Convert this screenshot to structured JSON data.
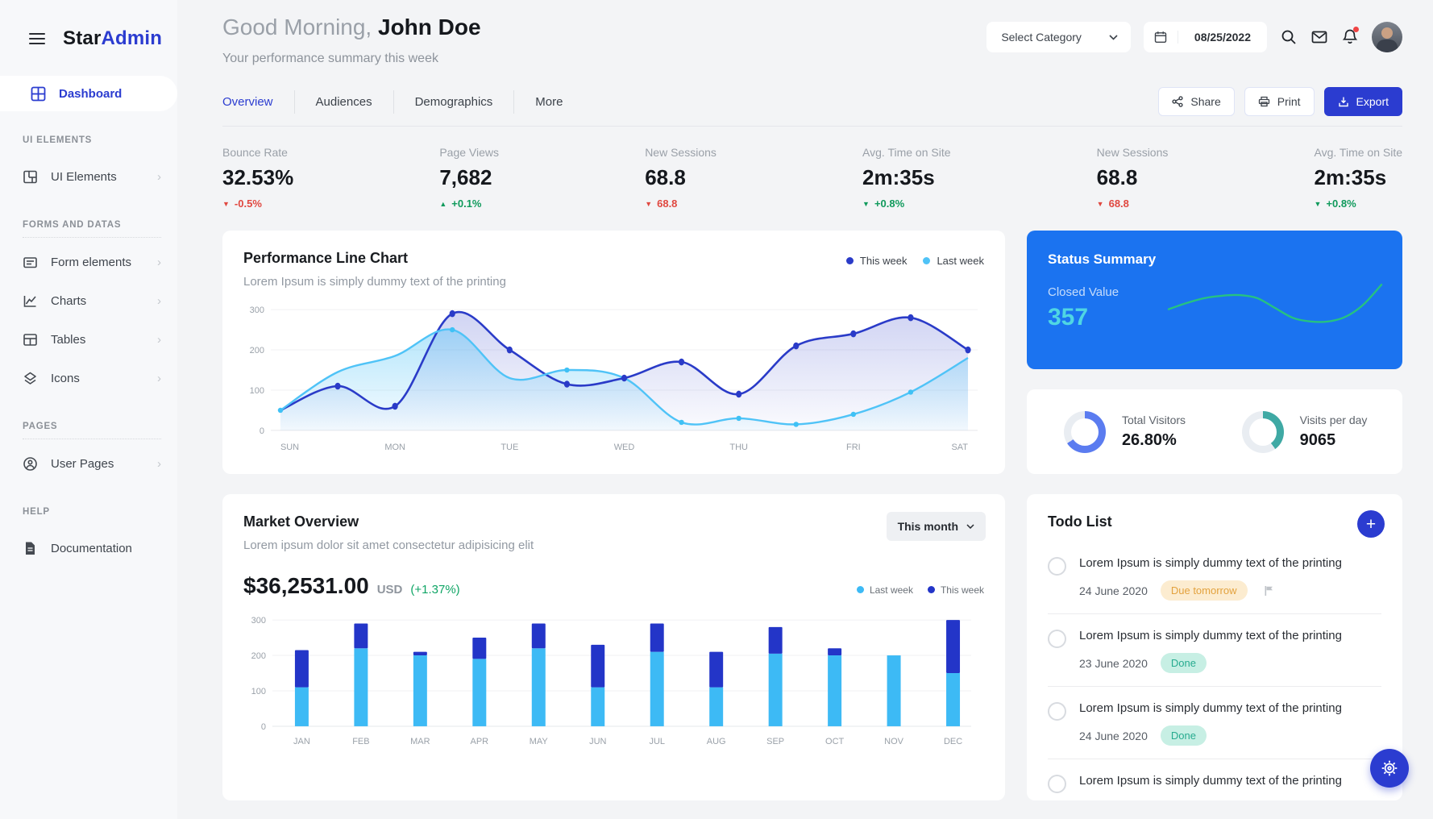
{
  "colors": {
    "primary": "#2b3cd0",
    "status_blue": "#1b73f0",
    "red": "#e04840",
    "green": "#109a5c",
    "grid": "#eef0f2"
  },
  "brand": {
    "star": "Star",
    "admin": "Admin"
  },
  "sidebar": {
    "active": "Dashboard",
    "sections": [
      {
        "title": "UI ELEMENTS",
        "items": [
          {
            "label": "UI Elements",
            "icon": "layout-icon",
            "chevron": true
          }
        ]
      },
      {
        "title": "FORMS AND DATAS",
        "items": [
          {
            "label": "Form elements",
            "icon": "form-icon",
            "chevron": true
          },
          {
            "label": "Charts",
            "icon": "chart-icon",
            "chevron": true
          },
          {
            "label": "Tables",
            "icon": "table-icon",
            "chevron": true
          },
          {
            "label": "Icons",
            "icon": "layers-icon",
            "chevron": true
          }
        ]
      },
      {
        "title": "PAGES",
        "items": [
          {
            "label": "User Pages",
            "icon": "user-icon",
            "chevron": true
          }
        ]
      },
      {
        "title": "HELP",
        "items": [
          {
            "label": "Documentation",
            "icon": "document-icon",
            "chevron": false
          }
        ]
      }
    ]
  },
  "header": {
    "greeting": "Good Morning,",
    "user": "John Doe",
    "subtitle": "Your performance summary this week",
    "category_select": "Select Category",
    "date": "08/25/2022"
  },
  "tabs": [
    {
      "label": "Overview",
      "active": true
    },
    {
      "label": "Audiences",
      "active": false
    },
    {
      "label": "Demographics",
      "active": false
    },
    {
      "label": "More",
      "active": false
    }
  ],
  "actions": {
    "share": "Share",
    "print": "Print",
    "export": "Export"
  },
  "stats": [
    {
      "label": "Bounce Rate",
      "value": "32.53%",
      "delta": "-0.5%",
      "direction": "down",
      "delta_color": "#e04840"
    },
    {
      "label": "Page Views",
      "value": "7,682",
      "delta": "+0.1%",
      "direction": "up",
      "delta_color": "#109a5c"
    },
    {
      "label": "New Sessions",
      "value": "68.8",
      "delta": "68.8",
      "direction": "down",
      "delta_color": "#e04840"
    },
    {
      "label": "Avg. Time on Site",
      "value": "2m:35s",
      "delta": "+0.8%",
      "direction": "down",
      "delta_color": "#109a5c"
    },
    {
      "label": "New Sessions",
      "value": "68.8",
      "delta": "68.8",
      "direction": "down",
      "delta_color": "#e04840"
    },
    {
      "label": "Avg. Time on Site",
      "value": "2m:35s",
      "delta": "+0.8%",
      "direction": "down",
      "delta_color": "#109a5c"
    }
  ],
  "performance_chart": {
    "title": "Performance Line Chart",
    "subtitle": "Lorem Ipsum is simply dummy text of the printing",
    "legend": [
      "This week",
      "Last week"
    ],
    "chart_data": {
      "type": "line",
      "x_axis_labels": [
        "SUN",
        "MON",
        "TUE",
        "WED",
        "THU",
        "FRI",
        "SAT"
      ],
      "points_per_day": 2,
      "y_ticks": [
        0,
        100,
        200,
        300
      ],
      "ylim": [
        0,
        300
      ],
      "grid": true,
      "legend_position": "top-right",
      "series": [
        {
          "name": "This week",
          "color": "#2a3bc8",
          "area": true,
          "values": [
            50,
            110,
            60,
            290,
            200,
            115,
            130,
            170,
            90,
            210,
            240,
            280,
            200
          ]
        },
        {
          "name": "Last week",
          "color": "#4fc3f7",
          "area": true,
          "values": [
            50,
            145,
            185,
            250,
            130,
            150,
            130,
            20,
            30,
            15,
            40,
            95,
            180
          ]
        }
      ]
    }
  },
  "status_summary": {
    "title": "Status Summary",
    "label": "Closed Value",
    "value": "357",
    "chart_data": {
      "type": "line",
      "name": "closed-value-sparkline",
      "color": "#26c281",
      "values": [
        40,
        50,
        58,
        62,
        63,
        58,
        42,
        26,
        20,
        20,
        28,
        48,
        80
      ]
    }
  },
  "visitors": {
    "items": [
      {
        "label": "Total Visitors",
        "value": "26.80%",
        "percent": 66,
        "color": "#5b7cf0"
      },
      {
        "label": "Visits per day",
        "value": "9065",
        "percent": 40,
        "color": "#3fa9a4"
      }
    ]
  },
  "market": {
    "title": "Market Overview",
    "subtitle": "Lorem ipsum dolor sit amet consectetur adipisicing elit",
    "period": "This month",
    "amount": "$36,2531.00",
    "currency": "USD",
    "change": "(+1.37%)",
    "legend": [
      "Last week",
      "This week"
    ],
    "chart_data": {
      "type": "bar",
      "stacked": true,
      "categories": [
        "JAN",
        "FEB",
        "MAR",
        "APR",
        "MAY",
        "JUN",
        "JUL",
        "AUG",
        "SEP",
        "OCT",
        "NOV",
        "DEC"
      ],
      "y_ticks": [
        0,
        100,
        200,
        300
      ],
      "ylim": [
        0,
        300
      ],
      "grid": true,
      "series": [
        {
          "name": "Last week",
          "color": "#3dbaf5",
          "values": [
            110,
            220,
            200,
            190,
            220,
            110,
            210,
            110,
            205,
            200,
            200,
            150
          ]
        },
        {
          "name": "This week",
          "color": "#2335c8",
          "values": [
            105,
            70,
            10,
            60,
            70,
            120,
            80,
            100,
            75,
            20,
            0,
            150
          ]
        }
      ]
    }
  },
  "todo": {
    "title": "Todo List",
    "items": [
      {
        "text": "Lorem Ipsum is simply dummy text of the printing",
        "date": "24 June 2020",
        "badge": "Due tomorrow",
        "badge_type": "due",
        "flag": true
      },
      {
        "text": "Lorem Ipsum is simply dummy text of the printing",
        "date": "23 June 2020",
        "badge": "Done",
        "badge_type": "done",
        "flag": false
      },
      {
        "text": "Lorem Ipsum is simply dummy text of the printing",
        "date": "24 June 2020",
        "badge": "Done",
        "badge_type": "done",
        "flag": false
      },
      {
        "text": "Lorem Ipsum is simply dummy text of the printing",
        "date": "",
        "badge": "",
        "badge_type": "",
        "flag": false
      }
    ]
  }
}
